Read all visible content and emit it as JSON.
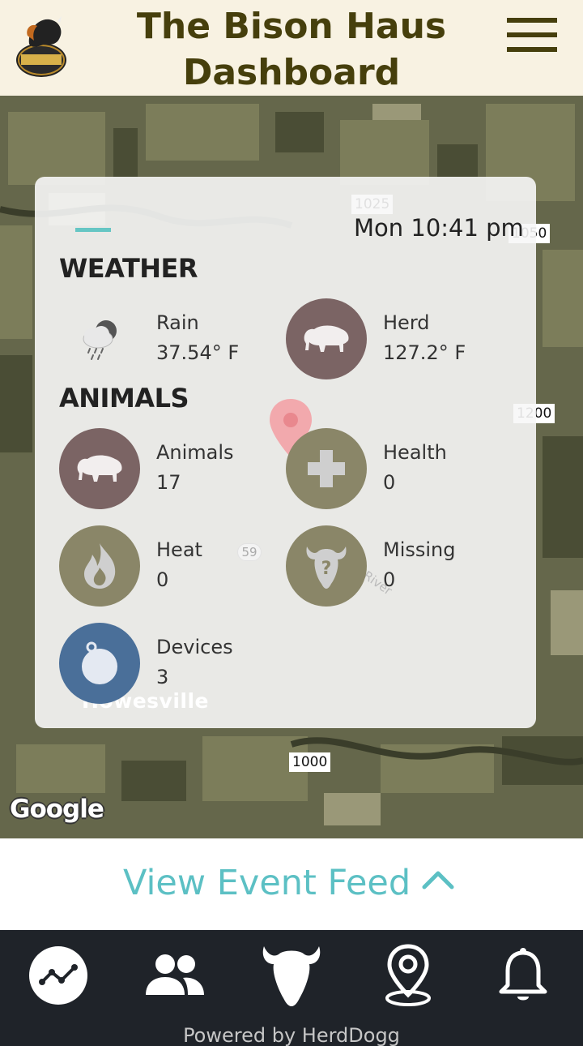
{
  "header": {
    "title_line1": "The Bison Haus",
    "title_line2": "Dashboard",
    "logo_text": "NATIONAL BISON ASSOCIATION",
    "menu_icon": "hamburger-menu-icon"
  },
  "map": {
    "road_labels": [
      "1025",
      "1050",
      "1200",
      "1000",
      "59"
    ],
    "place_label": "Howesville",
    "river_label": "River",
    "attribution": "Google"
  },
  "card": {
    "datetime": "Mon 10:41 pm",
    "weather_title": "WEATHER",
    "animals_title": "ANIMALS",
    "weather": [
      {
        "label": "Rain",
        "value": "37.54° F",
        "icon": "rain-cloud-icon"
      },
      {
        "label": "Herd",
        "value": "127.2° F",
        "icon": "bison-icon"
      }
    ],
    "animals": [
      {
        "label": "Animals",
        "value": "17",
        "icon": "bison-icon"
      },
      {
        "label": "Health",
        "value": "0",
        "icon": "health-cross-icon"
      },
      {
        "label": "Heat",
        "value": "0",
        "icon": "flame-icon"
      },
      {
        "label": "Missing",
        "value": "0",
        "icon": "missing-bison-icon"
      },
      {
        "label": "Devices",
        "value": "3",
        "icon": "device-tag-icon"
      }
    ]
  },
  "event_feed": {
    "label": "View Event Feed",
    "icon": "chevron-up-icon"
  },
  "bottom_nav": {
    "items": [
      "dashboard-icon",
      "people-icon",
      "bison-head-icon",
      "location-pin-icon",
      "bell-icon"
    ],
    "powered_by": "Powered by HerdDogg"
  },
  "colors": {
    "header_bg": "#f8f2e2",
    "title": "#463f0c",
    "accent": "#66c6c4",
    "herd_circle": "#7b6464",
    "olive_circle": "#8a8668",
    "device_circle": "#4a6f99",
    "nav_bg": "#1f2329"
  }
}
